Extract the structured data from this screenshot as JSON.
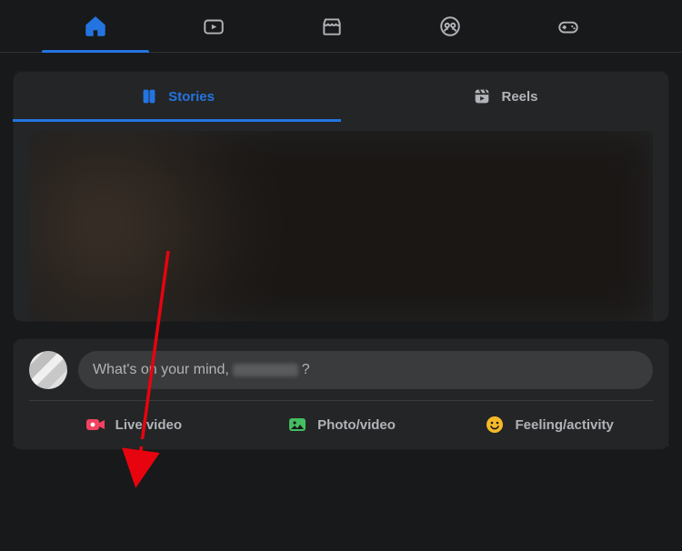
{
  "nav": {
    "items": [
      {
        "name": "home",
        "active": true
      },
      {
        "name": "watch",
        "active": false
      },
      {
        "name": "market",
        "active": false
      },
      {
        "name": "groups",
        "active": false
      },
      {
        "name": "gaming",
        "active": false
      }
    ]
  },
  "stories_reels": {
    "tabs": [
      {
        "label": "Stories",
        "active": true
      },
      {
        "label": "Reels",
        "active": false
      }
    ]
  },
  "composer": {
    "placeholder_prefix": "What's on your mind, ",
    "placeholder_suffix": "?",
    "actions": [
      {
        "label": "Live video",
        "icon": "live",
        "color": "#f3425f"
      },
      {
        "label": "Photo/video",
        "icon": "photo",
        "color": "#45bd62"
      },
      {
        "label": "Feeling/activity",
        "icon": "feeling",
        "color": "#f7b928"
      }
    ]
  }
}
